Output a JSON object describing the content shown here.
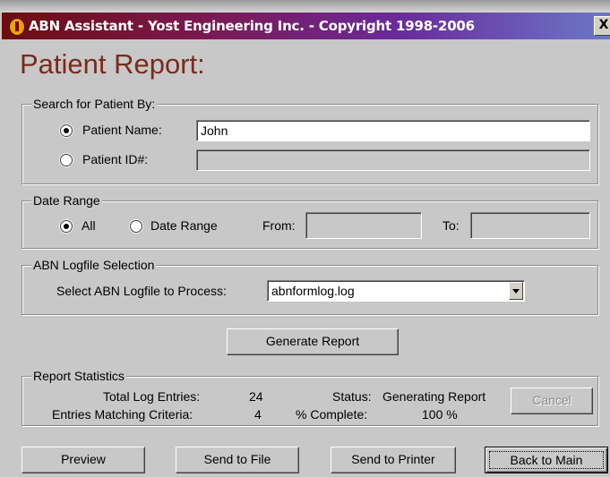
{
  "window": {
    "title": "ABN Assistant - Yost Engineering Inc. - Copyright 1998-2006",
    "close_label": "X"
  },
  "page_title": "Patient Report:",
  "search": {
    "legend": "Search for Patient By:",
    "patient_name_label": "Patient Name:",
    "patient_name_value": "John",
    "patient_id_label": "Patient ID#:",
    "patient_id_value": "",
    "selected": "patient_name"
  },
  "date_range": {
    "legend": "Date Range",
    "all_label": "All",
    "range_label": "Date Range",
    "from_label": "From:",
    "to_label": "To:",
    "from_value": "",
    "to_value": "",
    "selected": "all"
  },
  "logfile": {
    "legend": "ABN Logfile Selection",
    "label": "Select ABN Logfile to Process:",
    "value": "abnformlog.log"
  },
  "generate_label": "Generate Report",
  "stats": {
    "legend": "Report Statistics",
    "total_label": "Total Log Entries:",
    "total_value": "24",
    "matching_label": "Entries Matching Criteria:",
    "matching_value": "4",
    "status_label": "Status:",
    "status_value": "Generating Report",
    "complete_label": "% Complete:",
    "complete_value": "100 %",
    "cancel_label": "Cancel"
  },
  "footer": {
    "preview": "Preview",
    "send_file": "Send to File",
    "send_printer": "Send to Printer",
    "back_main": "Back to Main"
  },
  "colors": {
    "title_red": "#7a2b1b",
    "dialog_bg": "#c8c8c8"
  }
}
